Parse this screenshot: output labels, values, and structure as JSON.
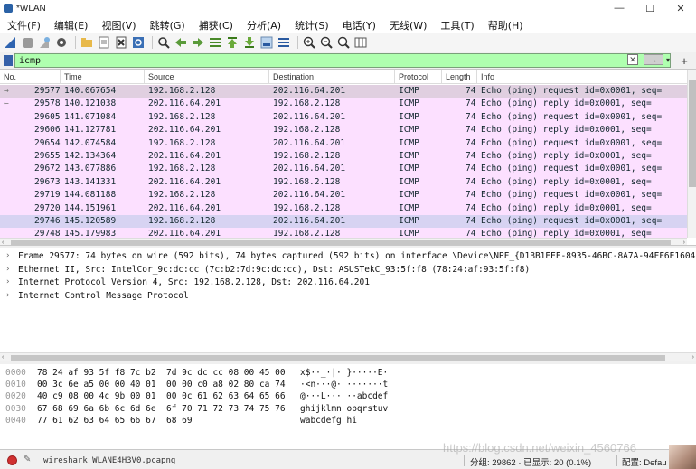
{
  "window": {
    "title": "*WLAN",
    "controls": [
      "—",
      "☐",
      "✕"
    ]
  },
  "menu": [
    "文件(F)",
    "编辑(E)",
    "视图(V)",
    "跳转(G)",
    "捕获(C)",
    "分析(A)",
    "统计(S)",
    "电话(Y)",
    "无线(W)",
    "工具(T)",
    "帮助(H)"
  ],
  "toolbar_icons": [
    "shark-fin-icon",
    "stop-icon",
    "restart-icon",
    "options-gear-icon",
    "open-folder-icon",
    "save-file-icon",
    "close-file-icon",
    "reload-icon",
    "find-icon",
    "back-arrow-icon",
    "forward-arrow-icon",
    "goto-icon",
    "first-packet-icon",
    "last-packet-icon",
    "autoscroll-icon",
    "colorize-icon",
    "zoom-in-icon",
    "zoom-out-icon",
    "zoom-reset-icon",
    "resize-columns-icon"
  ],
  "filter": {
    "value": "icmp",
    "clear": "✕",
    "apply": "→",
    "dropdown": "▾",
    "add": "+"
  },
  "packet_list": {
    "columns": [
      "No.",
      "Time",
      "Source",
      "Destination",
      "Protocol",
      "Length",
      "Info"
    ],
    "rows": [
      {
        "no": "29577",
        "time": "140.067654",
        "src": "192.168.2.128",
        "dst": "202.116.64.201",
        "proto": "ICMP",
        "len": "74",
        "info": "Echo (ping) request  id=0x0001, seq=",
        "mark": "→"
      },
      {
        "no": "29578",
        "time": "140.121038",
        "src": "202.116.64.201",
        "dst": "192.168.2.128",
        "proto": "ICMP",
        "len": "74",
        "info": "Echo (ping) reply    id=0x0001, seq=",
        "mark": "←"
      },
      {
        "no": "29605",
        "time": "141.071084",
        "src": "192.168.2.128",
        "dst": "202.116.64.201",
        "proto": "ICMP",
        "len": "74",
        "info": "Echo (ping) request  id=0x0001, seq=",
        "mark": ""
      },
      {
        "no": "29606",
        "time": "141.127781",
        "src": "202.116.64.201",
        "dst": "192.168.2.128",
        "proto": "ICMP",
        "len": "74",
        "info": "Echo (ping) reply    id=0x0001, seq=",
        "mark": ""
      },
      {
        "no": "29654",
        "time": "142.074584",
        "src": "192.168.2.128",
        "dst": "202.116.64.201",
        "proto": "ICMP",
        "len": "74",
        "info": "Echo (ping) request  id=0x0001, seq=",
        "mark": ""
      },
      {
        "no": "29655",
        "time": "142.134364",
        "src": "202.116.64.201",
        "dst": "192.168.2.128",
        "proto": "ICMP",
        "len": "74",
        "info": "Echo (ping) reply    id=0x0001, seq=",
        "mark": ""
      },
      {
        "no": "29672",
        "time": "143.077886",
        "src": "192.168.2.128",
        "dst": "202.116.64.201",
        "proto": "ICMP",
        "len": "74",
        "info": "Echo (ping) request  id=0x0001, seq=",
        "mark": ""
      },
      {
        "no": "29673",
        "time": "143.141331",
        "src": "202.116.64.201",
        "dst": "192.168.2.128",
        "proto": "ICMP",
        "len": "74",
        "info": "Echo (ping) reply    id=0x0001, seq=",
        "mark": ""
      },
      {
        "no": "29719",
        "time": "144.081188",
        "src": "192.168.2.128",
        "dst": "202.116.64.201",
        "proto": "ICMP",
        "len": "74",
        "info": "Echo (ping) request  id=0x0001, seq=",
        "mark": ""
      },
      {
        "no": "29720",
        "time": "144.151961",
        "src": "202.116.64.201",
        "dst": "192.168.2.128",
        "proto": "ICMP",
        "len": "74",
        "info": "Echo (ping) reply    id=0x0001, seq=",
        "mark": ""
      },
      {
        "no": "29746",
        "time": "145.120589",
        "src": "192.168.2.128",
        "dst": "202.116.64.201",
        "proto": "ICMP",
        "len": "74",
        "info": "Echo (ping) request  id=0x0001, seq=",
        "mark": ""
      },
      {
        "no": "29748",
        "time": "145.179983",
        "src": "202.116.64.201",
        "dst": "192.168.2.128",
        "proto": "ICMP",
        "len": "74",
        "info": "Echo (ping) reply    id=0x0001, seq=",
        "mark": ""
      }
    ]
  },
  "details": [
    "Frame 29577: 74 bytes on wire (592 bits), 74 bytes captured (592 bits) on interface \\Device\\NPF_{D1BB1EEE-8935-46BC-8A7A-94FF6E1604",
    "Ethernet II, Src: IntelCor_9c:dc:cc (7c:b2:7d:9c:dc:cc), Dst: ASUSTekC_93:5f:f8 (78:24:af:93:5f:f8)",
    "Internet Protocol Version 4, Src: 192.168.2.128, Dst: 202.116.64.201",
    "Internet Control Message Protocol"
  ],
  "bytes": [
    {
      "offset": "0000",
      "hex": "78 24 af 93 5f f8 7c b2  7d 9c dc cc 08 00 45 00",
      "ascii": "x$··_·|· }·····E·"
    },
    {
      "offset": "0010",
      "hex": "00 3c 6e a5 00 00 40 01  00 00 c0 a8 02 80 ca 74",
      "ascii": "·<n···@· ·······t"
    },
    {
      "offset": "0020",
      "hex": "40 c9 08 00 4c 9b 00 01  00 0c 61 62 63 64 65 66",
      "ascii": "@···L··· ··abcdef"
    },
    {
      "offset": "0030",
      "hex": "67 68 69 6a 6b 6c 6d 6e  6f 70 71 72 73 74 75 76",
      "ascii": "ghijklmn opqrstuv"
    },
    {
      "offset": "0040",
      "hex": "77 61 62 63 64 65 66 67  68 69",
      "ascii": "wabcdefg hi"
    }
  ],
  "status": {
    "file": "wireshark_WLANE4H3V0.pcapng",
    "packets": "分组: 29862 · 已显示: 20 (0.1%)",
    "profile": "配置: Defau"
  },
  "watermark": "https://blog.csdn.net/weixin_4560766",
  "colors": {
    "row_bg": "#fce0ff",
    "row_selected": "#e0cfe0",
    "row_highlight": "#d7d3f2",
    "filter_valid": "#afffaf"
  }
}
